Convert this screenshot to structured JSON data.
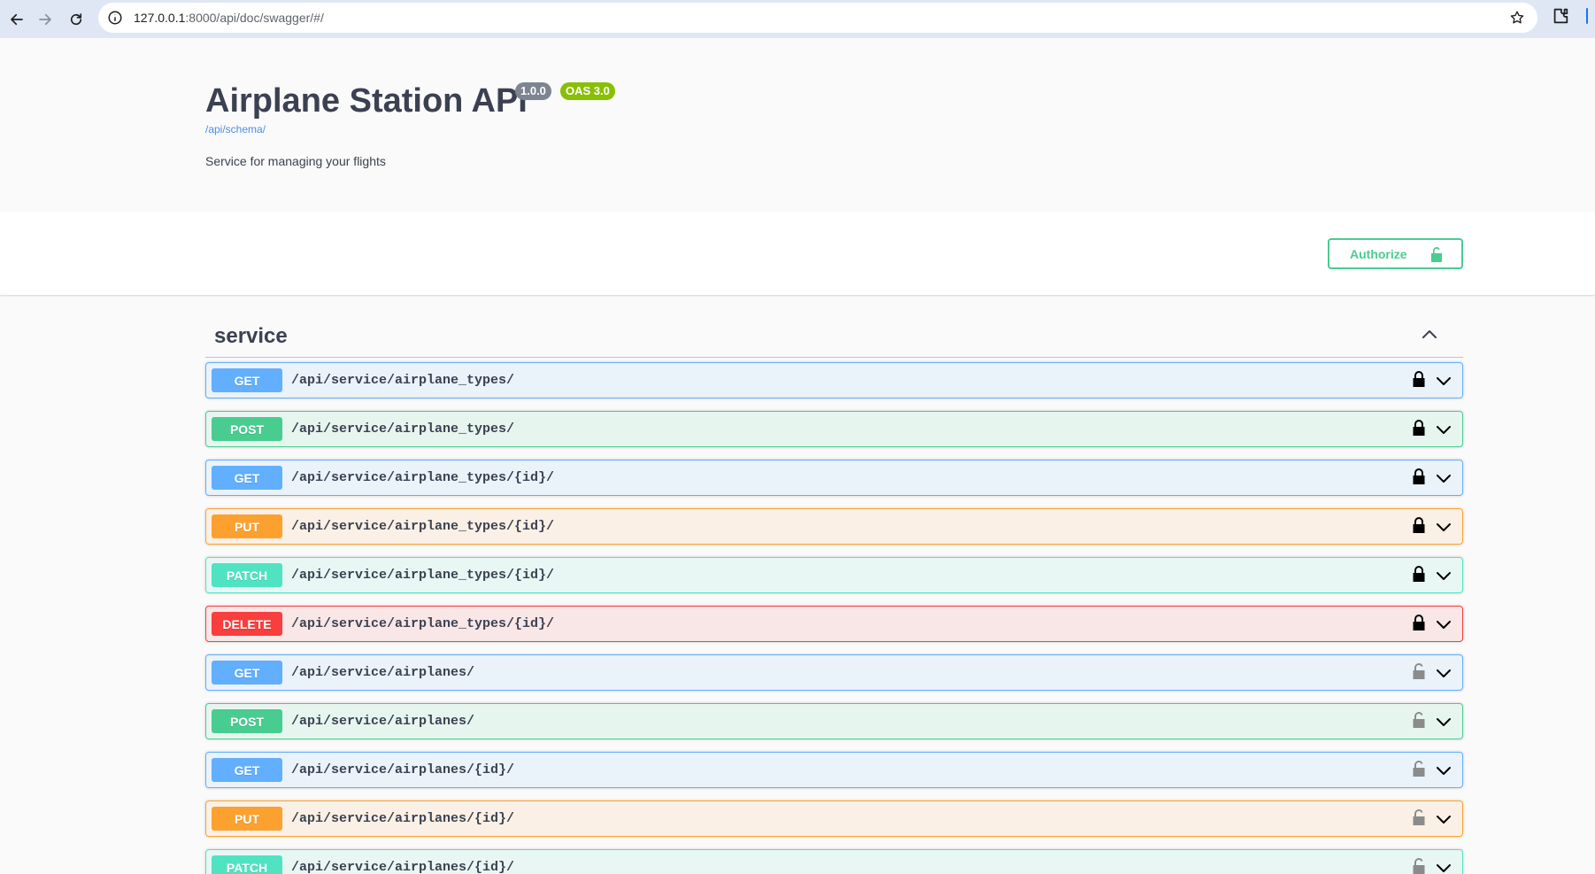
{
  "browser": {
    "url_host": "127.0.0.1",
    "url_rest": ":8000/api/doc/swagger/#/"
  },
  "info": {
    "title": "Airplane Station API",
    "version": "1.0.0",
    "oas": "OAS 3.0",
    "schema_link": "/api/schema/",
    "description": "Service for managing your flights"
  },
  "auth": {
    "authorize_label": "Authorize"
  },
  "tag": {
    "name": "service"
  },
  "operations": [
    {
      "method": "GET",
      "path": "/api/service/airplane_types/",
      "locked": true
    },
    {
      "method": "POST",
      "path": "/api/service/airplane_types/",
      "locked": true
    },
    {
      "method": "GET",
      "path": "/api/service/airplane_types/{id}/",
      "locked": true
    },
    {
      "method": "PUT",
      "path": "/api/service/airplane_types/{id}/",
      "locked": true
    },
    {
      "method": "PATCH",
      "path": "/api/service/airplane_types/{id}/",
      "locked": true
    },
    {
      "method": "DELETE",
      "path": "/api/service/airplane_types/{id}/",
      "locked": true
    },
    {
      "method": "GET",
      "path": "/api/service/airplanes/",
      "locked": false
    },
    {
      "method": "POST",
      "path": "/api/service/airplanes/",
      "locked": false
    },
    {
      "method": "GET",
      "path": "/api/service/airplanes/{id}/",
      "locked": false
    },
    {
      "method": "PUT",
      "path": "/api/service/airplanes/{id}/",
      "locked": false
    },
    {
      "method": "PATCH",
      "path": "/api/service/airplanes/{id}/",
      "locked": false
    }
  ],
  "colors": {
    "get": "#61affe",
    "post": "#49cc90",
    "put": "#fca130",
    "patch": "#50e3c2",
    "delete": "#f93e3e",
    "version_badge": "#7d8492",
    "oas_badge": "#89bf04"
  }
}
